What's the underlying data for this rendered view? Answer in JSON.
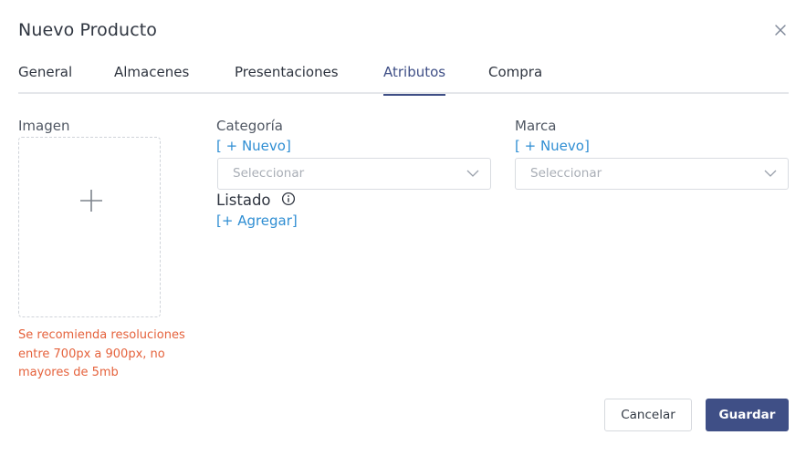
{
  "dialog": {
    "title": "Nuevo Producto"
  },
  "tabs": [
    {
      "label": "General",
      "active": false
    },
    {
      "label": "Almacenes",
      "active": false
    },
    {
      "label": "Presentaciones",
      "active": false
    },
    {
      "label": "Atributos",
      "active": true
    },
    {
      "label": "Compra",
      "active": false
    }
  ],
  "imagen": {
    "label": "Imagen",
    "hint": "Se recomienda resoluciones entre 700px a 900px, no mayores de 5mb"
  },
  "categoria": {
    "label": "Categoría",
    "add_link": "[ + Nuevo]",
    "placeholder": "Seleccionar"
  },
  "marca": {
    "label": "Marca",
    "add_link": "[ + Nuevo]",
    "placeholder": "Seleccionar"
  },
  "listado": {
    "label": "Listado",
    "add_link": "[+ Agregar]"
  },
  "actions": {
    "cancel_label": "Cancelar",
    "save_label": "Guardar"
  },
  "colors": {
    "accent": "#3f4f86",
    "link": "#2f8ed3",
    "hint": "#e5623c"
  }
}
